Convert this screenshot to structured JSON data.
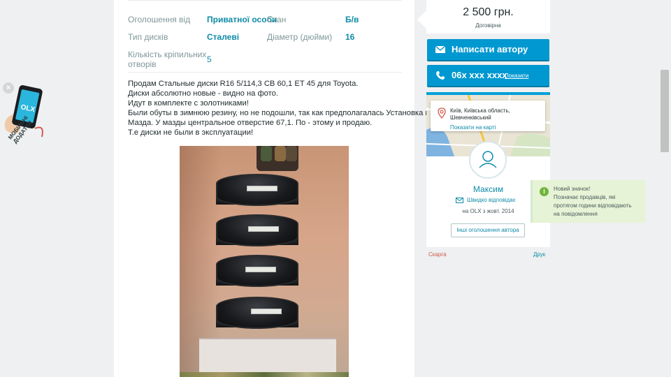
{
  "params": [
    {
      "label": "Оголошення від",
      "value": "Приватної особи"
    },
    {
      "label": "Стан",
      "value": "Б/в"
    },
    {
      "label": "Тип дисків",
      "value": "Сталеві"
    },
    {
      "label": "Діаметр (дюйми)",
      "value": "16"
    },
    {
      "label_line1": "Кількість кріпильних",
      "label_line2": "отворів",
      "value": "5"
    }
  ],
  "description": [
    "Продам Стальные диски R16 5/114,3 CB 60,1 ET 45 для Toyota.",
    "Диски абсолютно новые - видно на фото.",
    "Идут в комплекте с золотниками!",
    "Были обуты в зимнюю резину, но не подошли, так как предполагалась Установка на",
    "Мазда. У мазды центральное отверстие 67,1. По - этому и продаю.",
    "Т.е диски не были в эксплуатации!"
  ],
  "price": {
    "amount": "2 500 грн.",
    "note": "Договірна"
  },
  "contact": {
    "write_label": "Написати автору",
    "phone": "06x xxx xxxx",
    "show_label": "Показати"
  },
  "location": {
    "line1": "Київ, Київська область,",
    "line2": "Шевченківський",
    "map_link": "Показати на карті"
  },
  "seller": {
    "name": "Максим",
    "fast_reply": "Швидко відповідає",
    "since": "на OLX з жовт. 2014",
    "other_ads": "Інші оголошення автора"
  },
  "footer": {
    "complain": "Скарга",
    "print": "Друк"
  },
  "tooltip": {
    "icon": "i",
    "line1": "Новий значок!",
    "line2": "Позначає продавців, які",
    "line3": "протягом години відповідають",
    "line4": "на повідомлення"
  },
  "app_promo": {
    "close": "×",
    "logo": "OLX",
    "line1": "МОБІЛЬНІ",
    "line2": "ДОДАТКИ"
  },
  "colors": {
    "accent": "#0098d0",
    "link": "#0f8ba8",
    "tooltip_bg": "#e6f3d6",
    "tooltip_icon": "#6fb43b"
  }
}
